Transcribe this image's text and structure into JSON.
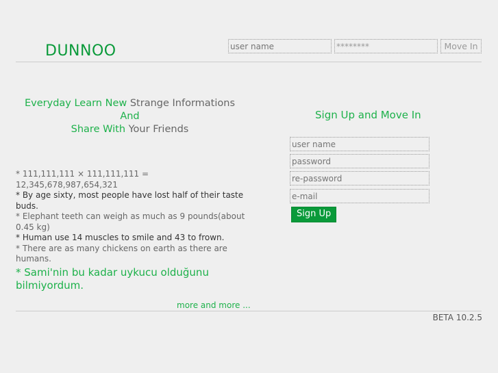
{
  "header": {
    "logo": "DUNNOO",
    "username_placeholder": "user name",
    "password_value": "********",
    "login_label": "Move In"
  },
  "tagline": {
    "line1_green": "Everyday Learn New",
    "line1_gray": "Strange Informations",
    "line2": "And",
    "line3_green": "Share With",
    "line3_gray": "Your Friends"
  },
  "facts": [
    "* 111,111,111 × 111,111,111 = 12,345,678,987,654,321",
    "* By age sixty, most people have lost half of their taste buds.",
    "* Elephant teeth can weigh as much as 9 pounds(about 0.45 kg)",
    "* Human use 14 muscles to smile and 43 to frown.",
    "* There are as many chickens on earth as there are humans.",
    "* Sami'nin bu kadar uykucu olduğunu bilmiyordum."
  ],
  "more_link": "more and more ...",
  "signup": {
    "title": "Sign Up and Move In",
    "username_placeholder": "user name",
    "password_placeholder": "password",
    "repassword_placeholder": "re-password",
    "email_placeholder": "e-mail",
    "button": "Sign Up"
  },
  "footer": {
    "version": "BETA 10.2.5"
  }
}
